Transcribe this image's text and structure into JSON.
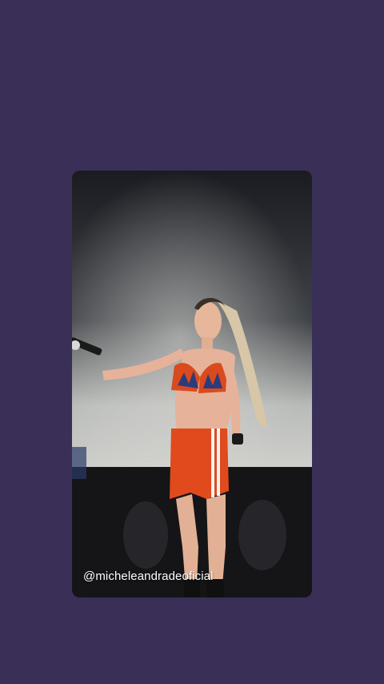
{
  "story": {
    "mention": "@micheleandradeoficial"
  }
}
